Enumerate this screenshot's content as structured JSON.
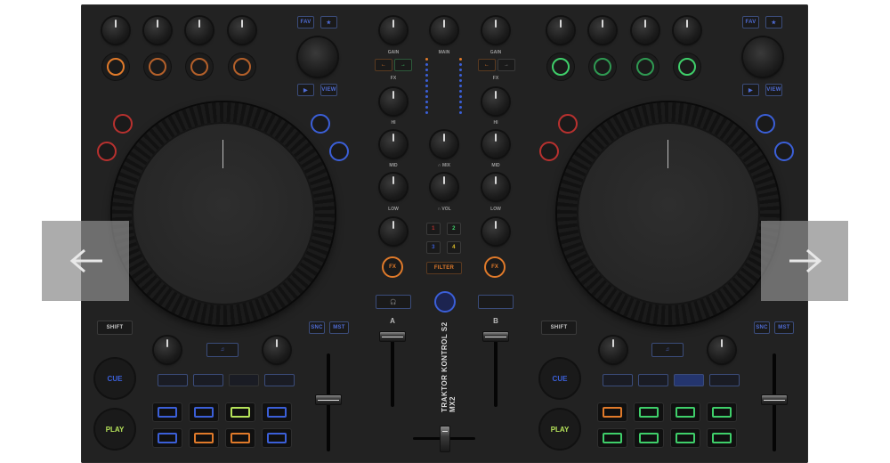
{
  "mixer": {
    "gain_left": "GAIN",
    "gain_right": "GAIN",
    "main": "MAIN",
    "fx_left": "FX",
    "fx_right": "FX",
    "hi_left": "HI",
    "hi_right": "HI",
    "mid_left": "MID",
    "mid_right": "MID",
    "mix": "∩ MIX",
    "low_left": "LOW",
    "low_right": "LOW",
    "vol": "∩ VOL",
    "fx_btn_left": "FX",
    "fx_btn_right": "FX",
    "pads": [
      "1",
      "2",
      "3",
      "4"
    ],
    "filter": "FILTER",
    "channel_a": "A",
    "channel_b": "B",
    "brand": "TRAKTOR KONTROL S2 MX2"
  },
  "left_deck": {
    "fav": "FAV",
    "star": "★",
    "play_small": "▶",
    "view": "VIEW",
    "shift": "SHIFT",
    "cue": "CUE",
    "play": "PLAY",
    "note_btn": "♫",
    "sync": "SNC",
    "mst": "MST"
  },
  "right_deck": {
    "fav": "FAV",
    "star": "★",
    "play_small": "▶",
    "view": "VIEW",
    "shift": "SHIFT",
    "cue": "CUE",
    "play": "PLAY",
    "note_btn": "♫",
    "sync": "SNC",
    "mst": "MST"
  },
  "colors": {
    "orange": "#e07a2a",
    "green": "#3fcf6a",
    "blue": "#3b5fd8",
    "red": "#b8312f",
    "yellow_green": "#b6e35a"
  },
  "navigation": {
    "prev_icon": "arrow-left-icon",
    "next_icon": "arrow-right-icon"
  }
}
